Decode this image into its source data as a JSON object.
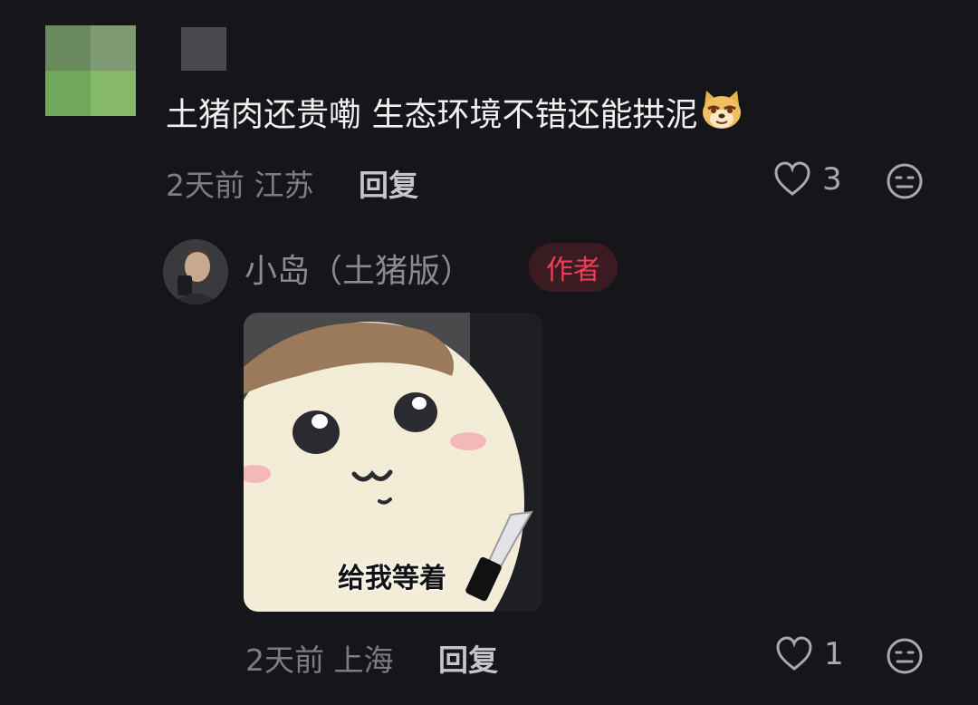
{
  "comment": {
    "text": "土猪肉还贵嘞 生态环境不错还能拱泥",
    "emoji": "doge-emoji",
    "time": "2天前",
    "location": "江苏",
    "reply_label": "回复",
    "like_count": "3"
  },
  "reply": {
    "author": "小岛（土猪版）",
    "badge": "作者",
    "sticker_caption": "给我等着",
    "time": "2天前",
    "location": "上海",
    "reply_label": "回复",
    "like_count": "1"
  },
  "colors": {
    "background": "#161519",
    "badge_text": "#f03d55",
    "badge_bg": "#3a1b21"
  }
}
